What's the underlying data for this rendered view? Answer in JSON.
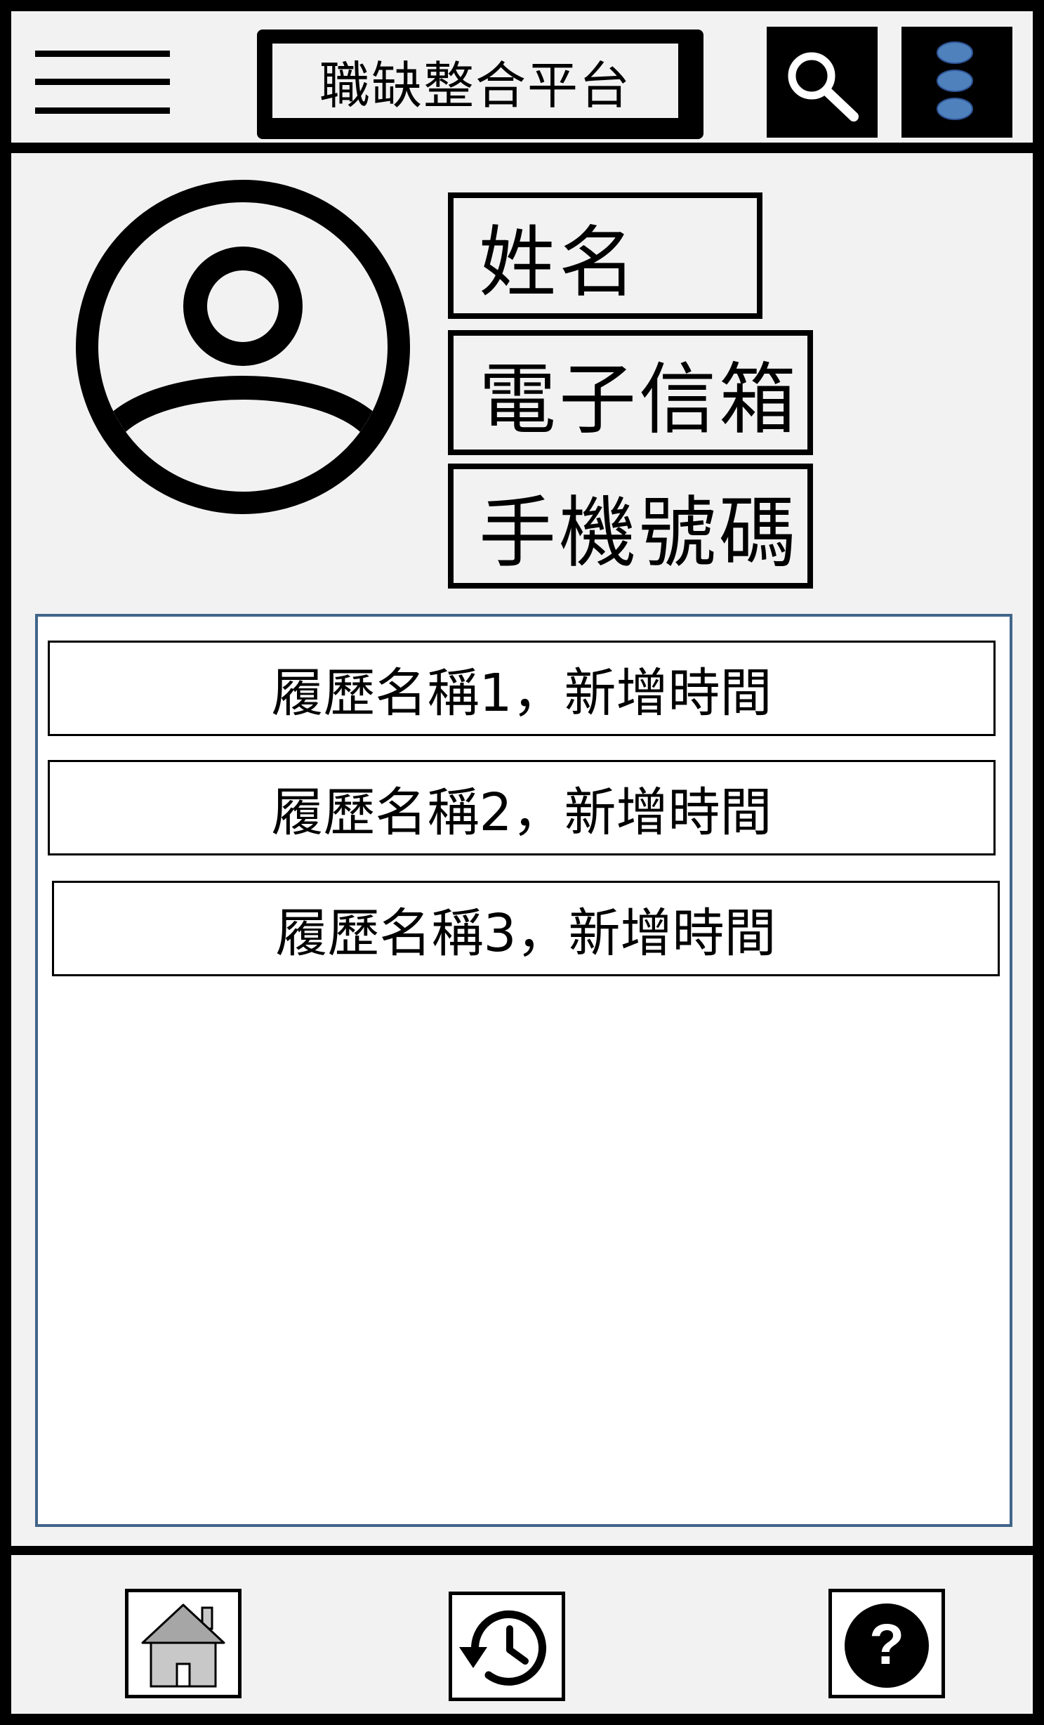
{
  "header": {
    "app_title": "職缺整合平台",
    "menu_icon": "hamburger-menu-icon",
    "search_icon": "search-icon",
    "more_icon": "more-vertical-icon",
    "more_dot_color": "#4f81bd"
  },
  "profile": {
    "avatar_icon": "user-avatar-icon",
    "name_label": "姓名",
    "email_label": "電子信箱",
    "phone_label": "手機號碼"
  },
  "resumes": [
    {
      "label": "履歷名稱1，新增時間"
    },
    {
      "label": "履歷名稱2，新增時間"
    },
    {
      "label": "履歷名稱3，新增時間"
    }
  ],
  "bottom_nav": {
    "home_icon": "home-icon",
    "history_icon": "history-icon",
    "help_icon": "help-icon"
  },
  "colors": {
    "background": "#f2f2f2",
    "panel_border": "#41658a",
    "accent_blue": "#4f81bd"
  }
}
